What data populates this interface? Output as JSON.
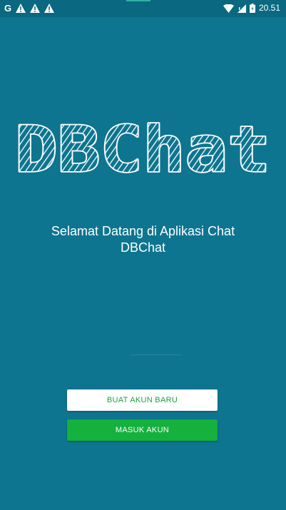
{
  "status_bar": {
    "left_icons": [
      "google-icon",
      "warning-icon",
      "warning-icon",
      "warning-icon"
    ],
    "right_icons": [
      "wifi-icon",
      "signal-icon",
      "battery-icon"
    ],
    "time": "20.51",
    "g_glyph": "G"
  },
  "logo": {
    "text": "DBChat"
  },
  "welcome": {
    "line1": "Selamat Datang di Aplikasi Chat",
    "line2": "DBChat"
  },
  "buttons": {
    "register_label": "BUAT AKUN BARU",
    "login_label": "MASUK AKUN"
  },
  "colors": {
    "background": "#0e7590",
    "status_bar": "#0a6881",
    "accent_green": "#14b13c",
    "white": "#ffffff"
  }
}
